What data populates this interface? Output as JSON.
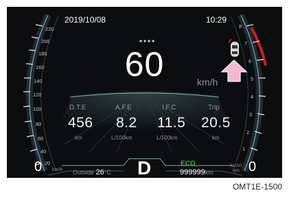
{
  "status_bar": {
    "date": "2019/10/08",
    "time": "10:29"
  },
  "speed": {
    "value": "60",
    "unit": "km/h"
  },
  "speed_scale": {
    "ticks": [
      "220",
      "200",
      "180",
      "160",
      "140",
      "120",
      "100",
      "80",
      "60",
      "40",
      "20",
      "0"
    ],
    "unit": "km/h"
  },
  "rpm_scale": {
    "ticks": [
      "8",
      "7",
      "6",
      "5",
      "4",
      "3",
      "2",
      "1",
      "0"
    ],
    "unit_line1": "X1000",
    "unit_line2": "rpm"
  },
  "trip_info": [
    {
      "label": "D.T.E",
      "value": "456",
      "unit": "km"
    },
    {
      "label": "A.F.E",
      "value": "8.2",
      "unit": "L/100km"
    },
    {
      "label": "I.F.C",
      "value": "11.5",
      "unit": "L/100km"
    },
    {
      "label": "Trip",
      "value": "20.5",
      "unit": "km"
    }
  ],
  "outside": {
    "label": "Outside",
    "value": "26",
    "unit": "°C"
  },
  "gear": "D",
  "eco": "ECO",
  "odometer": {
    "value": "999999",
    "unit": "km"
  },
  "caption": "OMT1E-1500",
  "colors": {
    "background": "#0b0d0f",
    "eco": "#2dbb4a",
    "redline": "#c7201e",
    "arrow": "#f3b7d0"
  }
}
